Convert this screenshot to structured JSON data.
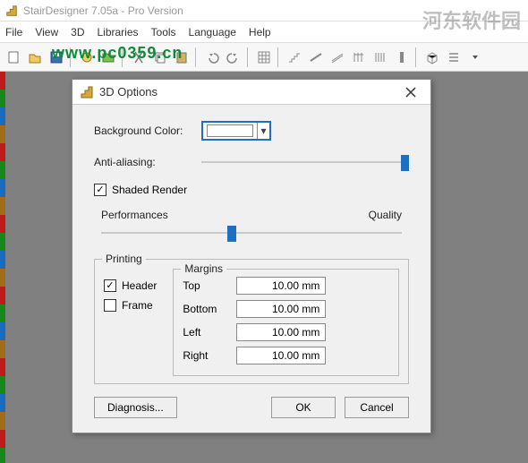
{
  "app": {
    "title": "StairDesigner 7.05a - Pro Version"
  },
  "menu": {
    "file": "File",
    "view": "View",
    "threeD": "3D",
    "libraries": "Libraries",
    "tools": "Tools",
    "language": "Language",
    "help": "Help"
  },
  "watermark": {
    "url": "www.pc0359.cn",
    "brand": "河东软件园"
  },
  "dialog": {
    "title": "3D Options",
    "bg_label": "Background Color:",
    "aa_label": "Anti-aliasing:",
    "shaded_label": "Shaded Render",
    "shaded_checked": "✓",
    "perf_label": "Performances",
    "quality_label": "Quality",
    "printing": {
      "legend": "Printing",
      "header_label": "Header",
      "header_checked": "✓",
      "frame_label": "Frame",
      "frame_checked": ""
    },
    "margins": {
      "legend": "Margins",
      "top_label": "Top",
      "top_val": "10.00 mm",
      "bottom_label": "Bottom",
      "bottom_val": "10.00 mm",
      "left_label": "Left",
      "left_val": "10.00 mm",
      "right_label": "Right",
      "right_val": "10.00 mm"
    },
    "buttons": {
      "diagnosis": "Diagnosis...",
      "ok": "OK",
      "cancel": "Cancel"
    }
  }
}
